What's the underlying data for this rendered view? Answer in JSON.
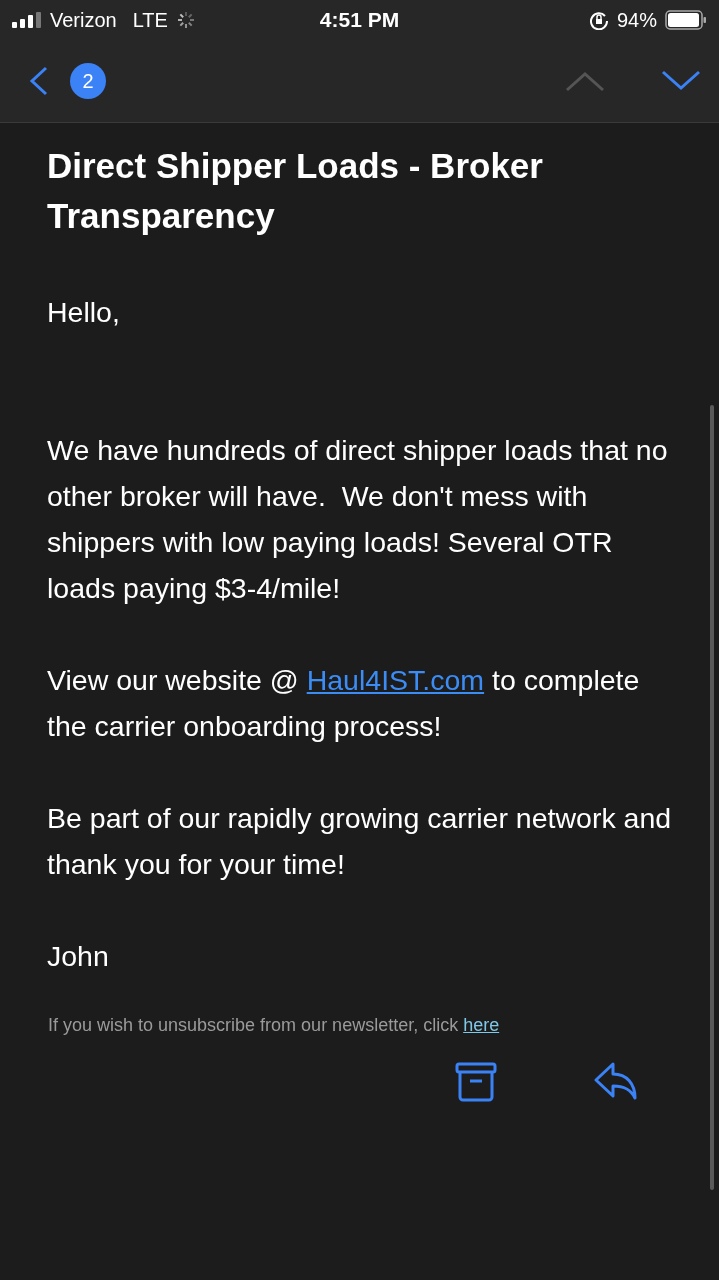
{
  "status_bar": {
    "carrier": "Verizon",
    "network": "LTE",
    "time": "4:51 PM",
    "battery": "94%"
  },
  "nav": {
    "back_badge": "2",
    "previous_disabled": true,
    "next_disabled": false
  },
  "message": {
    "subject": "Direct Shipper Loads - Broker Transparency",
    "body": [
      {
        "kind": "text",
        "text": "Hello,"
      },
      {
        "kind": "text",
        "text": "We have hundreds of direct shipper loads that no other broker will have.  We don't mess with shippers with low paying loads! Several OTR loads paying $3-4/mile!"
      },
      {
        "kind": "link_text",
        "before": "View our website @ ",
        "link": "Haul4IST.com",
        "after": " to complete the carrier onboarding process!"
      },
      {
        "kind": "text",
        "text": "Be part of our rapidly growing carrier network and thank you for your time!"
      },
      {
        "kind": "text",
        "text": "John"
      }
    ],
    "footer": {
      "text": "If you wish to unsubscribe from our newsletter, click ",
      "link": "here"
    }
  }
}
